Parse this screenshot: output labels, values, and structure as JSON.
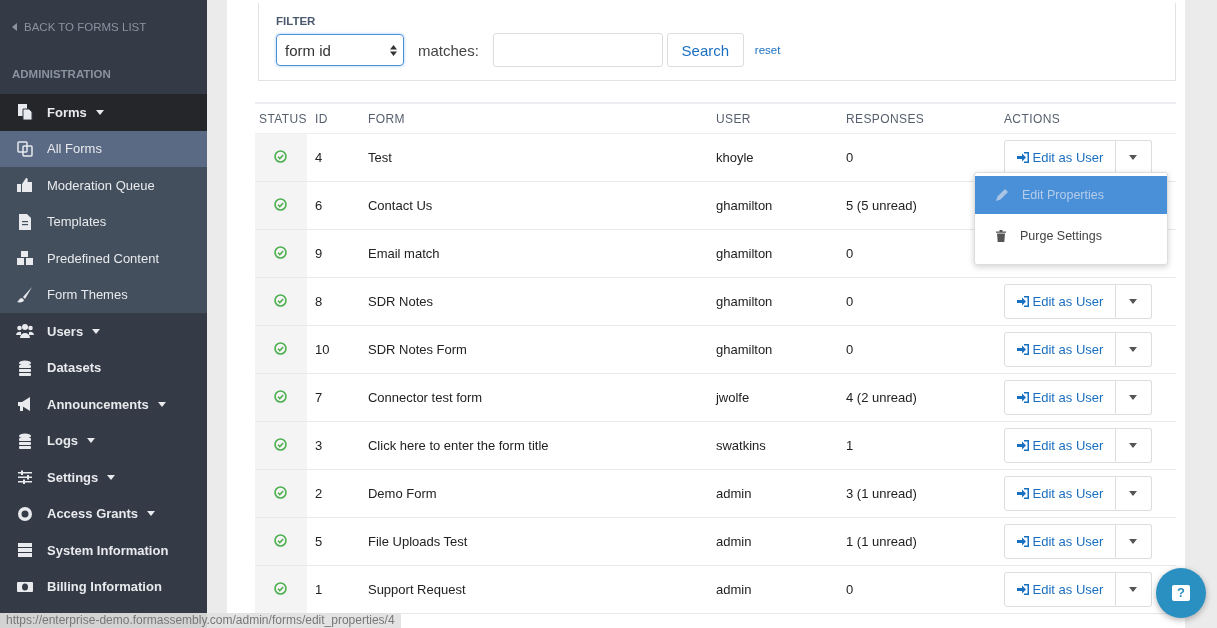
{
  "sidebar": {
    "back_link": "BACK TO FORMS LIST",
    "section": "ADMINISTRATION",
    "items": [
      {
        "label": "Forms",
        "kind": "menu",
        "selected": false,
        "expanded": true,
        "children": [
          {
            "label": "All Forms",
            "selected": true
          },
          {
            "label": "Moderation Queue",
            "selected": false
          },
          {
            "label": "Templates",
            "selected": false
          },
          {
            "label": "Predefined Content",
            "selected": false
          },
          {
            "label": "Form Themes",
            "selected": false
          }
        ]
      },
      {
        "label": "Users",
        "kind": "menu",
        "selected": false,
        "expanded": false
      },
      {
        "label": "Datasets",
        "kind": "link",
        "selected": false
      },
      {
        "label": "Announcements",
        "kind": "menu",
        "selected": false,
        "expanded": false
      },
      {
        "label": "Logs",
        "kind": "menu",
        "selected": false,
        "expanded": false
      },
      {
        "label": "Settings",
        "kind": "menu",
        "selected": false,
        "expanded": false
      },
      {
        "label": "Access Grants",
        "kind": "menu",
        "selected": false,
        "expanded": false
      },
      {
        "label": "System Information",
        "kind": "link",
        "selected": false
      },
      {
        "label": "Billing Information",
        "kind": "link",
        "selected": false
      }
    ]
  },
  "filter": {
    "title": "FILTER",
    "field": "form id",
    "matches_label": "matches:",
    "search_button": "Search",
    "reset_link": "reset"
  },
  "table": {
    "columns": [
      "STATUS",
      "ID",
      "FORM",
      "USER",
      "RESPONSES",
      "ACTIONS"
    ],
    "rows": [
      {
        "active": true,
        "id": "4",
        "form": "Test",
        "user": "khoyle",
        "responses": "0",
        "action": "Edit as User"
      },
      {
        "active": true,
        "id": "6",
        "form": "Contact Us",
        "user": "ghamilton",
        "responses": "5 (5 unread)"
      },
      {
        "active": true,
        "id": "9",
        "form": "Email match",
        "user": "ghamilton",
        "responses": "0"
      },
      {
        "active": true,
        "id": "8",
        "form": "SDR Notes",
        "user": "ghamilton",
        "responses": "0",
        "action": "Edit as User"
      },
      {
        "active": true,
        "id": "10",
        "form": "SDR Notes Form",
        "user": "ghamilton",
        "responses": "0",
        "action": "Edit as User"
      },
      {
        "active": true,
        "id": "7",
        "form": "Connector test form",
        "user": "jwolfe",
        "responses": "4 (2 unread)",
        "action": "Edit as User"
      },
      {
        "active": true,
        "id": "3",
        "form": "Click here to enter the form title",
        "user": "swatkins",
        "responses": "1",
        "action": "Edit as User"
      },
      {
        "active": true,
        "id": "2",
        "form": "Demo Form",
        "user": "admin",
        "responses": "3 (1 unread)",
        "action": "Edit as User"
      },
      {
        "active": true,
        "id": "5",
        "form": "File Uploads Test",
        "user": "admin",
        "responses": "1 (1 unread)",
        "action": "Edit as User"
      },
      {
        "active": true,
        "id": "1",
        "form": "Support Request",
        "user": "admin",
        "responses": "0",
        "action": "Edit as User"
      }
    ]
  },
  "action_menu": {
    "items": [
      {
        "label": "Edit Properties",
        "selected": true
      },
      {
        "label": "Purge Settings",
        "selected": false
      }
    ]
  },
  "help_button": {
    "label": "?"
  },
  "status_url": "https://enterprise-demo.formassembly.com/admin/forms/edit_properties/4"
}
